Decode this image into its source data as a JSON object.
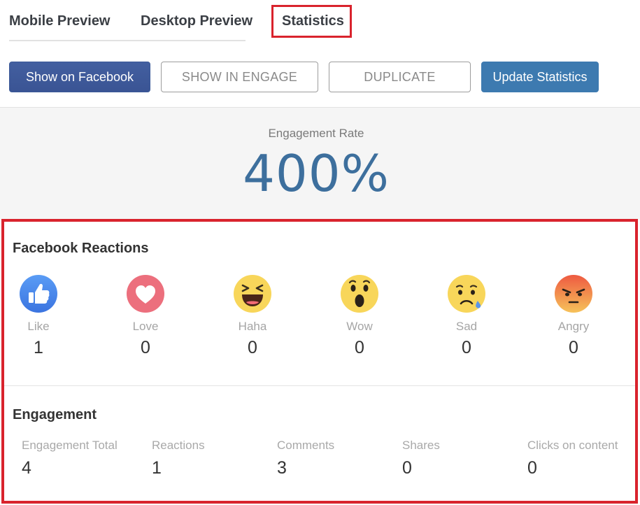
{
  "tabs": [
    {
      "label": "Mobile Preview"
    },
    {
      "label": "Desktop Preview"
    },
    {
      "label": "Statistics"
    }
  ],
  "active_tab": "Statistics",
  "buttons": {
    "show_on_facebook": "Show on Facebook",
    "show_in_engage": "SHOW IN ENGAGE",
    "duplicate": "DUPLICATE",
    "update_statistics": "Update Statistics"
  },
  "engagement_rate": {
    "label": "Engagement Rate",
    "value": "400%"
  },
  "facebook_reactions": {
    "title": "Facebook Reactions",
    "items": [
      {
        "label": "Like",
        "count": "1",
        "icon": "like-icon"
      },
      {
        "label": "Love",
        "count": "0",
        "icon": "love-icon"
      },
      {
        "label": "Haha",
        "count": "0",
        "icon": "haha-icon"
      },
      {
        "label": "Wow",
        "count": "0",
        "icon": "wow-icon"
      },
      {
        "label": "Sad",
        "count": "0",
        "icon": "sad-icon"
      },
      {
        "label": "Angry",
        "count": "0",
        "icon": "angry-icon"
      }
    ]
  },
  "engagement": {
    "title": "Engagement",
    "items": [
      {
        "label": "Engagement Total",
        "value": "4"
      },
      {
        "label": "Reactions",
        "value": "1"
      },
      {
        "label": "Comments",
        "value": "3"
      },
      {
        "label": "Shares",
        "value": "0"
      },
      {
        "label": "Clicks on content",
        "value": "0"
      }
    ]
  },
  "colors": {
    "facebook_blue": "#3b5998",
    "update_blue": "#3d7ab0",
    "rate_blue": "#3d6f9d",
    "highlight_red": "#d9232d"
  }
}
